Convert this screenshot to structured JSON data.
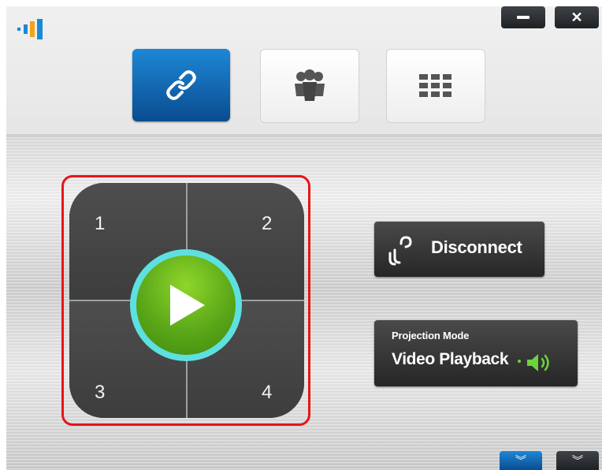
{
  "window": {
    "controls": {
      "minimize_icon": "minimize-icon",
      "close_icon": "close-icon",
      "close_glyph": "✕"
    }
  },
  "tabs": [
    {
      "name": "link",
      "icon": "link-icon",
      "active": true
    },
    {
      "name": "people",
      "icon": "people-icon",
      "active": false
    },
    {
      "name": "apps",
      "icon": "grid-icon",
      "active": false
    }
  ],
  "split_grid": {
    "cells": [
      "1",
      "2",
      "3",
      "4"
    ],
    "play_icon": "play-icon",
    "highlight_color": "#e8141a"
  },
  "disconnect": {
    "label": "Disconnect",
    "icon": "disconnect-icon"
  },
  "projection": {
    "title": "Projection Mode",
    "value": "Video Playback",
    "icon": "speaker-icon",
    "accent_color": "#6cd33a"
  },
  "bottom_buttons": [
    {
      "icon": "chevron-double-down-icon",
      "glyph": "︾"
    },
    {
      "icon": "chevron-double-down-icon",
      "glyph": "︾"
    }
  ],
  "colors": {
    "accent_blue": "#1d87d6",
    "play_green": "#5aa719",
    "ring_cyan": "#5fe0e0"
  }
}
